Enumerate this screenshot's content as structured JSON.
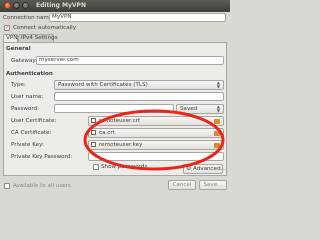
{
  "window": {
    "title": "Editing MyVPN"
  },
  "connection": {
    "name_label": "Connection name:",
    "name_value": "MyVPN",
    "auto_connect_label": "Connect automatically"
  },
  "tabs": [
    {
      "label": "VPN"
    },
    {
      "label": "IPv4 Settings"
    }
  ],
  "general": {
    "heading": "General",
    "gateway_label": "Gateway:",
    "gateway_value": "myserver.com"
  },
  "authentication": {
    "heading": "Authentication",
    "type_label": "Type:",
    "type_value": "Password with Certificates (TLS)",
    "username_label": "User name:",
    "username_value": "",
    "password_label": "Password:",
    "password_value": "",
    "password_mode": "Saved",
    "user_cert_label": "User Certificate:",
    "user_cert_value": "remoteuser.crt",
    "ca_cert_label": "CA Certificate:",
    "ca_cert_value": "ca.crt",
    "private_key_label": "Private Key:",
    "private_key_value": "remoteuser.key",
    "private_key_password_label": "Private Key Password:",
    "private_key_password_value": "",
    "show_passwords_label": "Show passwords",
    "advanced_label": "Advanced..."
  },
  "footer": {
    "all_users_label": "Available to all users",
    "cancel_label": "Cancel",
    "save_label": "Save..."
  },
  "colors": {
    "accent": "#e0541c",
    "annotation": "#e8261c",
    "window_bg": "#edece8"
  },
  "icons": [
    "close-icon",
    "minimize-icon",
    "maximize-icon",
    "checkmark-icon",
    "dropdown-arrows-icon",
    "file-icon",
    "folder-icon",
    "gear-icon"
  ]
}
